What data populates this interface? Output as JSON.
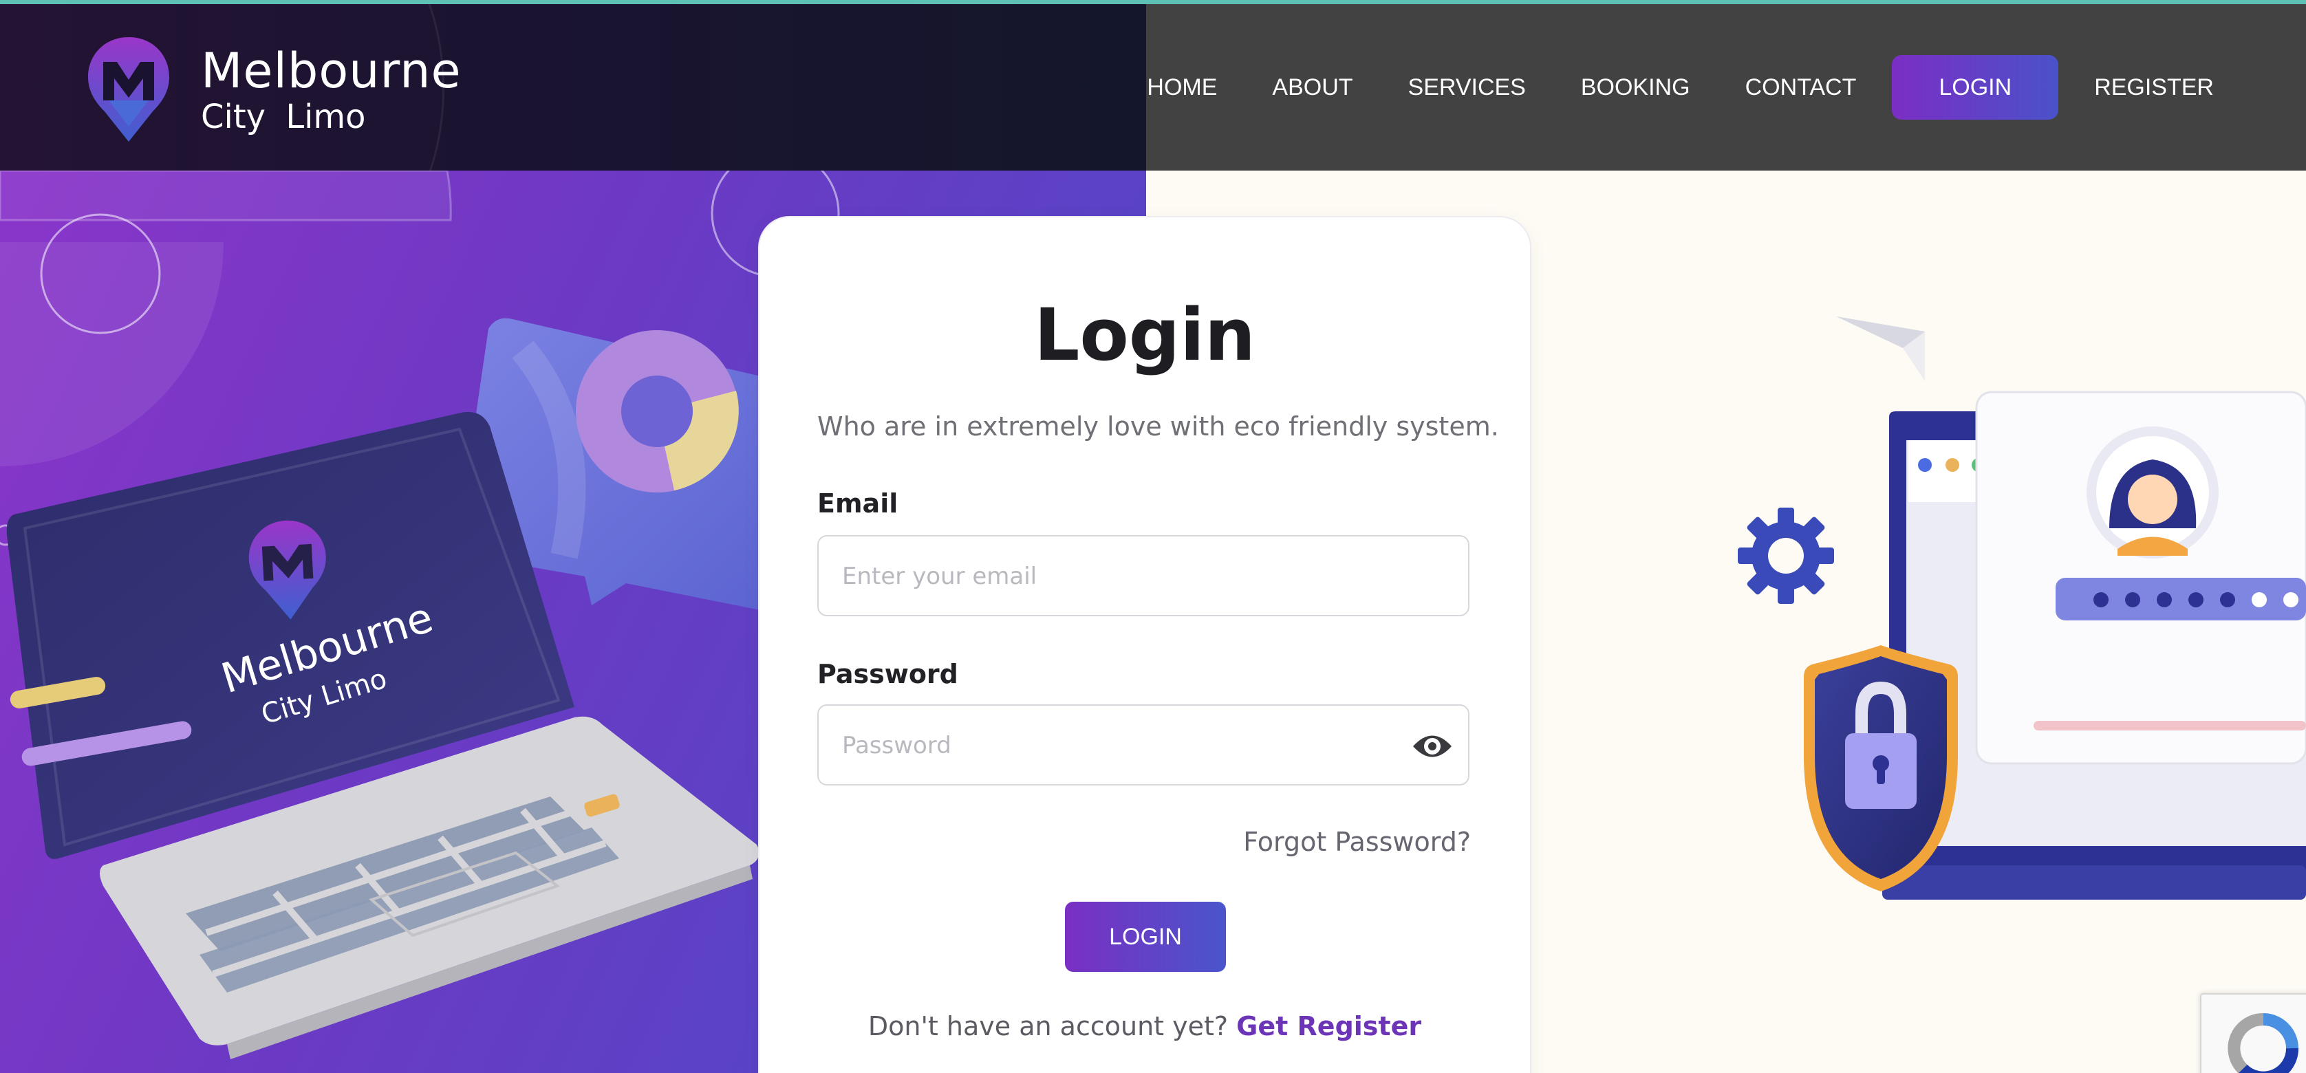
{
  "brand": {
    "title": "Melbourne",
    "subtitle": "City Limo"
  },
  "nav": {
    "items": [
      {
        "label": "HOME"
      },
      {
        "label": "ABOUT"
      },
      {
        "label": "SERVICES"
      },
      {
        "label": "BOOKING"
      },
      {
        "label": "CONTACT"
      },
      {
        "label": "LOGIN",
        "active": true
      },
      {
        "label": "REGISTER"
      }
    ]
  },
  "login": {
    "title": "Login",
    "subtitle": "Who are in extremely love with eco friendly system.",
    "email_label": "Email",
    "email_placeholder": "Enter your email",
    "email_value": "",
    "password_label": "Password",
    "password_placeholder": "Password",
    "password_value": "",
    "password_toggle_icon": "eye-icon",
    "forgot_label": "Forgot Password?",
    "submit_label": "LOGIN",
    "no_account_text": "Don't have an account yet?",
    "register_link_label": "Get Register"
  },
  "illustration_left": {
    "laptop_logo_title": "Melbourne",
    "laptop_logo_subtitle": "City Limo"
  },
  "colors": {
    "accent_start": "#7b2ec4",
    "accent_end": "#4a52c9",
    "header_right_bg": "#424242",
    "link_color": "#6c35b8"
  },
  "icons": [
    "logo-pin-icon",
    "eye-icon",
    "gear-icon",
    "lock-icon",
    "shield-icon",
    "paper-plane-icon",
    "recaptcha-icon"
  ]
}
